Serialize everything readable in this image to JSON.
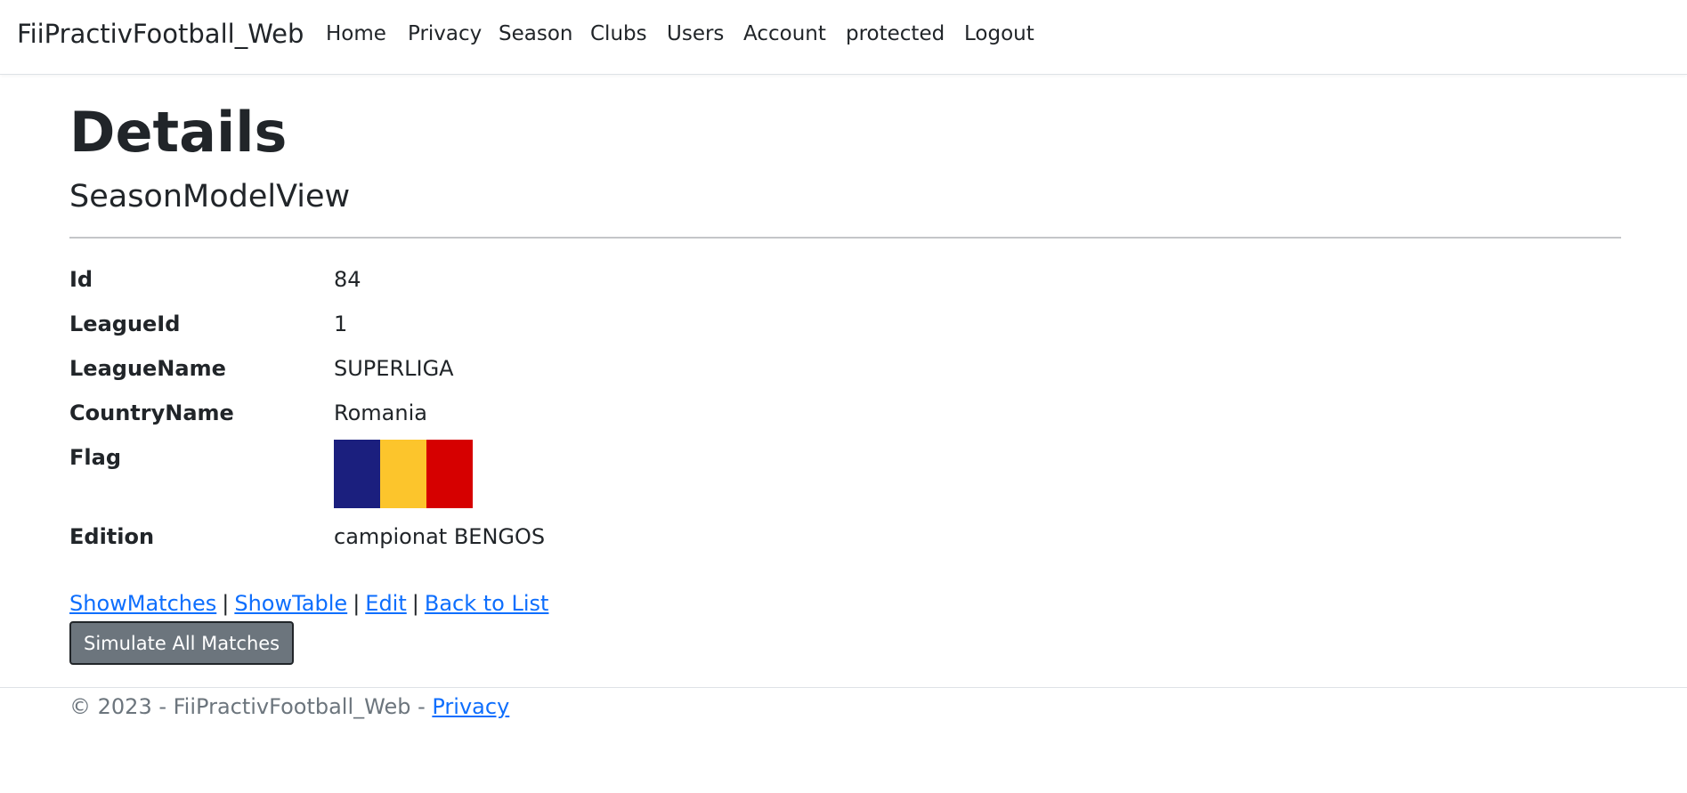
{
  "navbar": {
    "brand": "FiiPractivFootball_Web",
    "items": [
      {
        "label": "Home"
      },
      {
        "label": "Privacy"
      },
      {
        "label": "Season"
      },
      {
        "label": "Clubs"
      },
      {
        "label": "Users"
      },
      {
        "label": "Account"
      },
      {
        "label": "protected"
      },
      {
        "label": "Logout"
      }
    ]
  },
  "page": {
    "title": "Details",
    "subtitle": "SeasonModelView"
  },
  "details": {
    "id": {
      "label": "Id",
      "value": "84"
    },
    "league_id": {
      "label": "LeagueId",
      "value": "1"
    },
    "league_name": {
      "label": "LeagueName",
      "value": "SUPERLIGA"
    },
    "country_name": {
      "label": "CountryName",
      "value": "Romania"
    },
    "flag": {
      "label": "Flag",
      "colors": [
        "#1b1f7e",
        "#fcc52c",
        "#d60000"
      ]
    },
    "edition": {
      "label": "Edition",
      "value": "campionat BENGOS"
    }
  },
  "actions": {
    "links": [
      {
        "label": "ShowMatches"
      },
      {
        "label": "ShowTable"
      },
      {
        "label": "Edit"
      },
      {
        "label": "Back to List"
      }
    ],
    "separator": "|",
    "simulate_button": "Simulate All Matches"
  },
  "footer": {
    "text": "© 2023 - FiiPractivFootball_Web - ",
    "privacy_link": "Privacy"
  },
  "colors": {
    "link": "#0d6efd",
    "button_bg": "#6c757d",
    "text": "#212529",
    "muted": "#6c757d"
  }
}
